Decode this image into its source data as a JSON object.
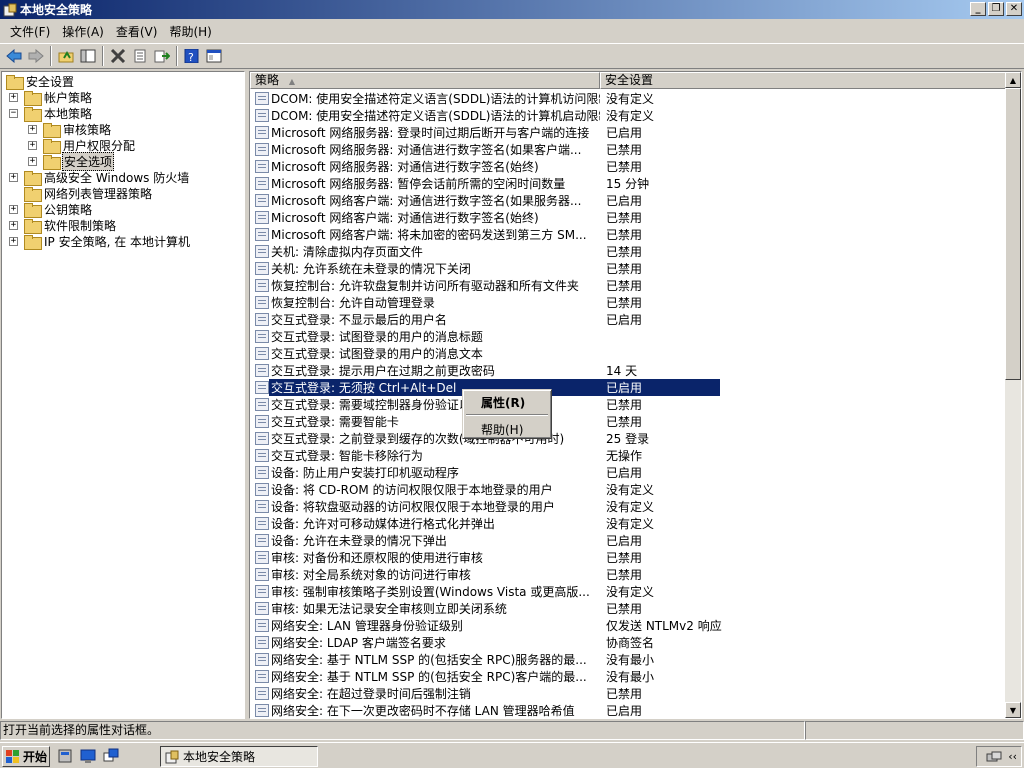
{
  "window": {
    "title": "本地安全策略",
    "controls": {
      "minimize": "_",
      "restore": "❐",
      "close": "✕"
    }
  },
  "menu": [
    "文件(F)",
    "操作(A)",
    "查看(V)",
    "帮助(H)"
  ],
  "toolbar_icons": [
    "back-arrow-icon",
    "forward-arrow-icon",
    "up-folder-icon",
    "show-hide-tree-icon",
    "delete-icon",
    "properties-icon",
    "export-list-icon",
    "help-icon",
    "console-icon"
  ],
  "tree": [
    {
      "label": "安全设置",
      "expander": "",
      "level": 0,
      "icon": "security-settings"
    },
    {
      "label": "帐户策略",
      "expander": "+",
      "level": 1,
      "icon": "folder"
    },
    {
      "label": "本地策略",
      "expander": "−",
      "level": 1,
      "icon": "folder"
    },
    {
      "label": "审核策略",
      "expander": "+",
      "level": 2,
      "icon": "folder"
    },
    {
      "label": "用户权限分配",
      "expander": "+",
      "level": 2,
      "icon": "folder"
    },
    {
      "label": "安全选项",
      "expander": "+",
      "level": 2,
      "icon": "folder",
      "selected": true
    },
    {
      "label": "高级安全 Windows 防火墙",
      "expander": "+",
      "level": 1,
      "icon": "folder"
    },
    {
      "label": "网络列表管理器策略",
      "expander": "",
      "level": 1,
      "icon": "folder"
    },
    {
      "label": "公钥策略",
      "expander": "+",
      "level": 1,
      "icon": "folder"
    },
    {
      "label": "软件限制策略",
      "expander": "+",
      "level": 1,
      "icon": "folder"
    },
    {
      "label": "IP 安全策略, 在 本地计算机",
      "expander": "+",
      "level": 1,
      "icon": "ipsec"
    }
  ],
  "list": {
    "headers": {
      "policy": "策略",
      "sort_indicator": "▲",
      "setting": "安全设置"
    },
    "rows": [
      {
        "policy": "DCOM: 使用安全描述符定义语言(SDDL)语法的计算机访问限制",
        "setting": "没有定义"
      },
      {
        "policy": "DCOM: 使用安全描述符定义语言(SDDL)语法的计算机启动限制",
        "setting": "没有定义"
      },
      {
        "policy": "Microsoft 网络服务器: 登录时间过期后断开与客户端的连接",
        "setting": "已启用"
      },
      {
        "policy": "Microsoft 网络服务器: 对通信进行数字签名(如果客户端...",
        "setting": "已禁用"
      },
      {
        "policy": "Microsoft 网络服务器: 对通信进行数字签名(始终)",
        "setting": "已禁用"
      },
      {
        "policy": "Microsoft 网络服务器: 暂停会话前所需的空闲时间数量",
        "setting": "15 分钟"
      },
      {
        "policy": "Microsoft 网络客户端: 对通信进行数字签名(如果服务器...",
        "setting": "已启用"
      },
      {
        "policy": "Microsoft 网络客户端: 对通信进行数字签名(始终)",
        "setting": "已禁用"
      },
      {
        "policy": "Microsoft 网络客户端: 将未加密的密码发送到第三方 SM...",
        "setting": "已禁用"
      },
      {
        "policy": "关机: 清除虚拟内存页面文件",
        "setting": "已禁用"
      },
      {
        "policy": "关机: 允许系统在未登录的情况下关闭",
        "setting": "已禁用"
      },
      {
        "policy": "恢复控制台: 允许软盘复制并访问所有驱动器和所有文件夹",
        "setting": "已禁用"
      },
      {
        "policy": "恢复控制台: 允许自动管理登录",
        "setting": "已禁用"
      },
      {
        "policy": "交互式登录: 不显示最后的用户名",
        "setting": "已启用"
      },
      {
        "policy": "交互式登录: 试图登录的用户的消息标题",
        "setting": ""
      },
      {
        "policy": "交互式登录: 试图登录的用户的消息文本",
        "setting": ""
      },
      {
        "policy": "交互式登录: 提示用户在过期之前更改密码",
        "setting": "14 天"
      },
      {
        "policy": "交互式登录: 无须按 Ctrl+Alt+Del",
        "setting": "已启用",
        "selected": true
      },
      {
        "policy": "交互式登录: 需要域控制器身份验证以解锁",
        "setting": "已禁用"
      },
      {
        "policy": "交互式登录: 需要智能卡",
        "setting": "已禁用"
      },
      {
        "policy": "交互式登录: 之前登录到缓存的次数(域控制器不可用时)",
        "setting": "25 登录"
      },
      {
        "policy": "交互式登录: 智能卡移除行为",
        "setting": "无操作"
      },
      {
        "policy": "设备: 防止用户安装打印机驱动程序",
        "setting": "已启用"
      },
      {
        "policy": "设备: 将 CD-ROM 的访问权限仅限于本地登录的用户",
        "setting": "没有定义"
      },
      {
        "policy": "设备: 将软盘驱动器的访问权限仅限于本地登录的用户",
        "setting": "没有定义"
      },
      {
        "policy": "设备: 允许对可移动媒体进行格式化并弹出",
        "setting": "没有定义"
      },
      {
        "policy": "设备: 允许在未登录的情况下弹出",
        "setting": "已启用"
      },
      {
        "policy": "审核: 对备份和还原权限的使用进行审核",
        "setting": "已禁用"
      },
      {
        "policy": "审核: 对全局系统对象的访问进行审核",
        "setting": "已禁用"
      },
      {
        "policy": "审核: 强制审核策略子类别设置(Windows Vista 或更高版...",
        "setting": "没有定义"
      },
      {
        "policy": "审核: 如果无法记录安全审核则立即关闭系统",
        "setting": "已禁用"
      },
      {
        "policy": "网络安全: LAN 管理器身份验证级别",
        "setting": "仅发送 NTLMv2 响应"
      },
      {
        "policy": "网络安全: LDAP 客户端签名要求",
        "setting": "协商签名"
      },
      {
        "policy": "网络安全: 基于 NTLM SSP 的(包括安全 RPC)服务器的最...",
        "setting": "没有最小"
      },
      {
        "policy": "网络安全: 基于 NTLM SSP 的(包括安全 RPC)客户端的最...",
        "setting": "没有最小"
      },
      {
        "policy": "网络安全: 在超过登录时间后强制注销",
        "setting": "已禁用"
      },
      {
        "policy": "网络安全: 在下一次更改密码时不存储 LAN 管理器哈希值",
        "setting": "已启用"
      }
    ]
  },
  "context_menu": {
    "properties": "属性(R)",
    "help": "帮助(H)"
  },
  "status": "打开当前选择的属性对话框。",
  "taskbar": {
    "start": "开始",
    "task": "本地安全策略"
  },
  "colors": {
    "titlebar": "#0a246a",
    "selection": "#0a246a",
    "face": "#d4d0c8"
  }
}
